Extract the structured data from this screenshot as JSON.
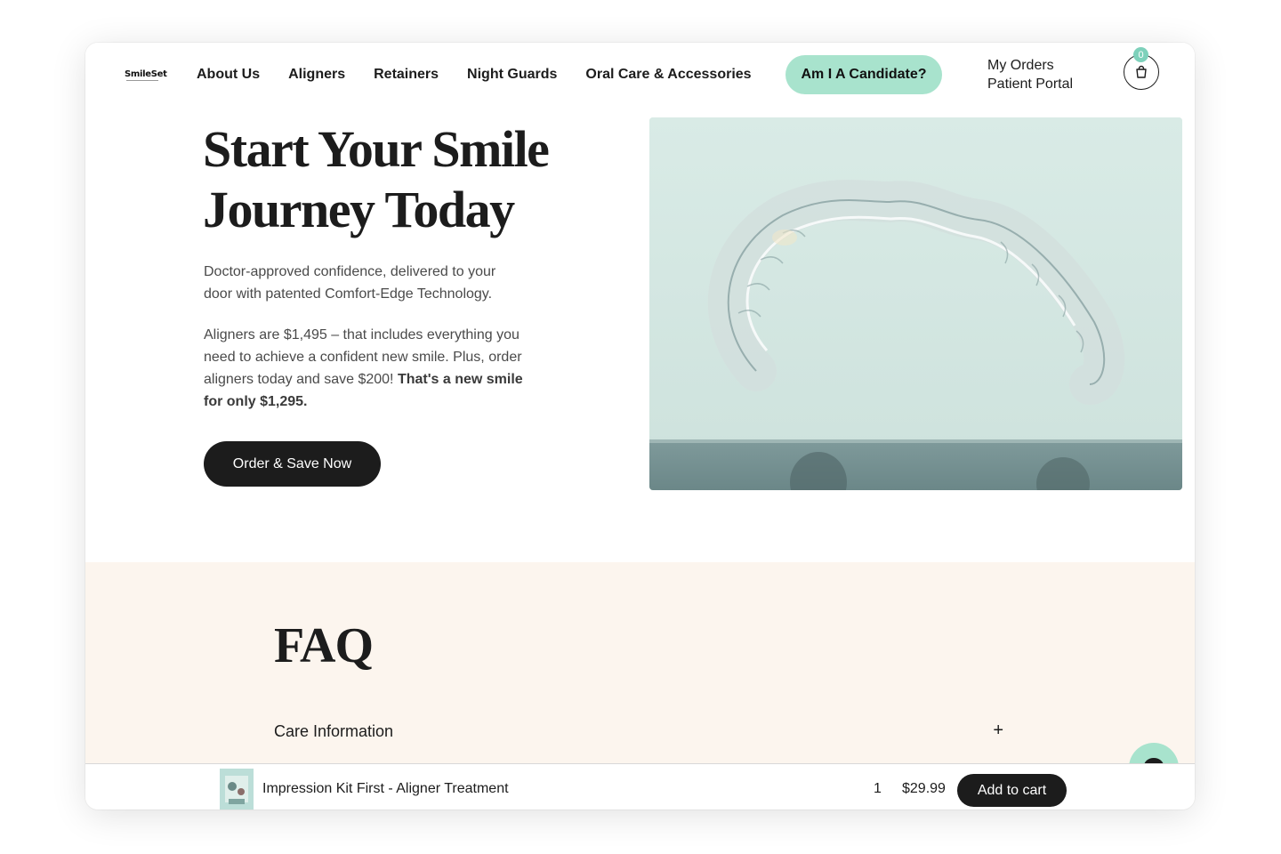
{
  "brand": {
    "logo_text": "SmileSet"
  },
  "nav": {
    "items": [
      {
        "label": "About Us"
      },
      {
        "label": "Aligners"
      },
      {
        "label": "Retainers"
      },
      {
        "label": "Night Guards"
      },
      {
        "label": "Oral Care & Accessories"
      }
    ],
    "candidate_button": "Am I A Candidate?",
    "my_orders": "My Orders",
    "patient_portal": "Patient Portal",
    "cart_count": "0",
    "cart_icon": "shopping-bag-icon"
  },
  "hero": {
    "title_line1": "Start Your Smile",
    "title_line2": "Journey Today",
    "paragraph1": "Doctor-approved confidence, delivered to your door with patented Comfort-Edge Technology.",
    "paragraph2_plain": "Aligners are $1,495 – that includes everything you need to achieve a confident new smile. Plus, order aligners today and save $200! ",
    "paragraph2_bold": "That's a new smile for only $1,295.",
    "cta_label": "Order & Save Now",
    "image_subject": "clear-aligner-photo"
  },
  "faq": {
    "title": "FAQ",
    "items": [
      {
        "label": "Care Information",
        "toggle": "+"
      }
    ]
  },
  "chat": {
    "icon": "chat-bubble-icon"
  },
  "sticky_bar": {
    "product_name": "Impression Kit First - Aligner Treatment",
    "quantity": "1",
    "price": "$29.99",
    "add_to_cart": "Add to cart"
  },
  "colors": {
    "accent_mint": "#a8e3cd",
    "dark": "#1c1c1c",
    "faq_background": "#fcf5ee",
    "hero_image_bg": "#d6e9e4"
  }
}
